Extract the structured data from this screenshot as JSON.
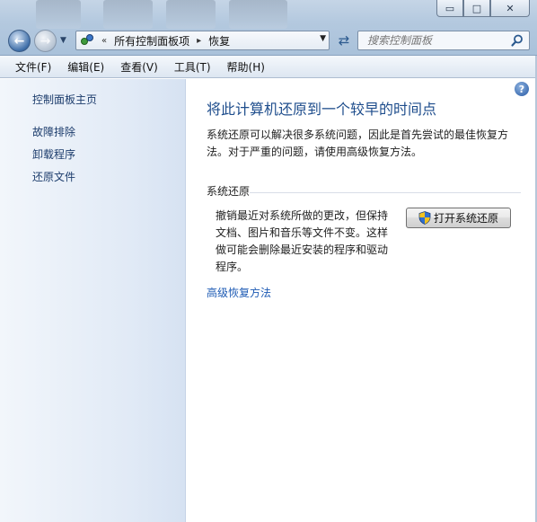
{
  "window": {
    "caption_buttons": {
      "minimize": "▭",
      "maximize": "□",
      "close": "✕"
    }
  },
  "navigation": {
    "back_icon": "back-arrow-icon",
    "forward_icon": "forward-arrow-icon",
    "breadcrumb_overflow": "«",
    "breadcrumbs": [
      "所有控制面板项",
      "恢复"
    ],
    "breadcrumb_separator": "▸",
    "search_placeholder": "搜索控制面板"
  },
  "menubar": {
    "items": [
      "文件(F)",
      "编辑(E)",
      "查看(V)",
      "工具(T)",
      "帮助(H)"
    ]
  },
  "sidebar": {
    "home_link": "控制面板主页",
    "links": [
      "故障排除",
      "卸载程序",
      "还原文件"
    ]
  },
  "main": {
    "help_glyph": "?",
    "title": "将此计算机还原到一个较早的时间点",
    "description": "系统还原可以解决很多系统问题，因此是首先尝试的最佳恢复方法。对于严重的问题，请使用高级恢复方法。",
    "section_label": "系统还原",
    "restore_description": "撤销最近对系统所做的更改，但保持文档、图片和音乐等文件不变。这样做可能会删除最近安装的程序和驱动程序。",
    "open_restore_button": "打开系统还原",
    "advanced_link": "高级恢复方法"
  },
  "colors": {
    "title": "#1e4d8c",
    "link": "#1e5bb4",
    "sidebar_link": "#1c3c6c"
  }
}
